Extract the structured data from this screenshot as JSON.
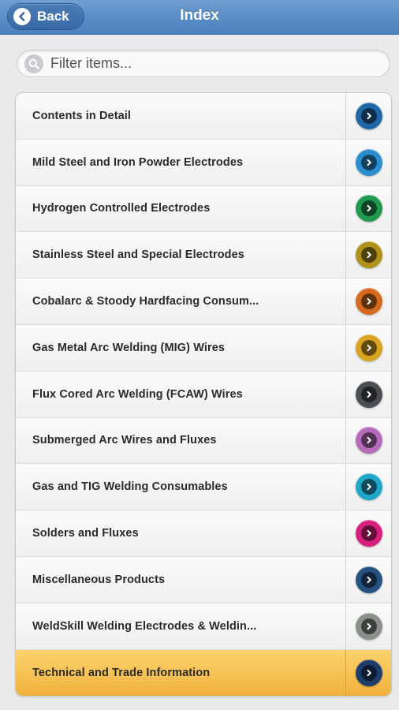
{
  "header": {
    "title": "Index",
    "back_label": "Back"
  },
  "search": {
    "placeholder": "Filter items..."
  },
  "items": [
    {
      "label": "Contents in Detail",
      "color": "#2067a8",
      "active": false
    },
    {
      "label": "Mild Steel and Iron Powder Electrodes",
      "color": "#2a8fd0",
      "active": false
    },
    {
      "label": "Hydrogen Controlled Electrodes",
      "color": "#1f9a4e",
      "active": false
    },
    {
      "label": "Stainless Steel and Special Electrodes",
      "color": "#b0911a",
      "active": false
    },
    {
      "label": "Cobalarc & Stoody Hardfacing Consum...",
      "color": "#d66a1e",
      "active": false
    },
    {
      "label": "Gas Metal Arc Welding (MIG) Wires",
      "color": "#d9a520",
      "active": false
    },
    {
      "label": "Flux Cored Arc Welding (FCAW) Wires",
      "color": "#4a4d52",
      "active": false
    },
    {
      "label": "Submerged Arc Wires and Fluxes",
      "color": "#b56dba",
      "active": false
    },
    {
      "label": "Gas and TIG Welding Consumables",
      "color": "#1fa8c9",
      "active": false
    },
    {
      "label": "Solders and Fluxes",
      "color": "#d81f7e",
      "active": false
    },
    {
      "label": "Miscellaneous Products",
      "color": "#26507f",
      "active": false
    },
    {
      "label": "WeldSkill Welding Electrodes & Weldin...",
      "color": "#8a918a",
      "active": false
    },
    {
      "label": "Technical and Trade Information",
      "color": "#1f3d6a",
      "active": true
    }
  ]
}
